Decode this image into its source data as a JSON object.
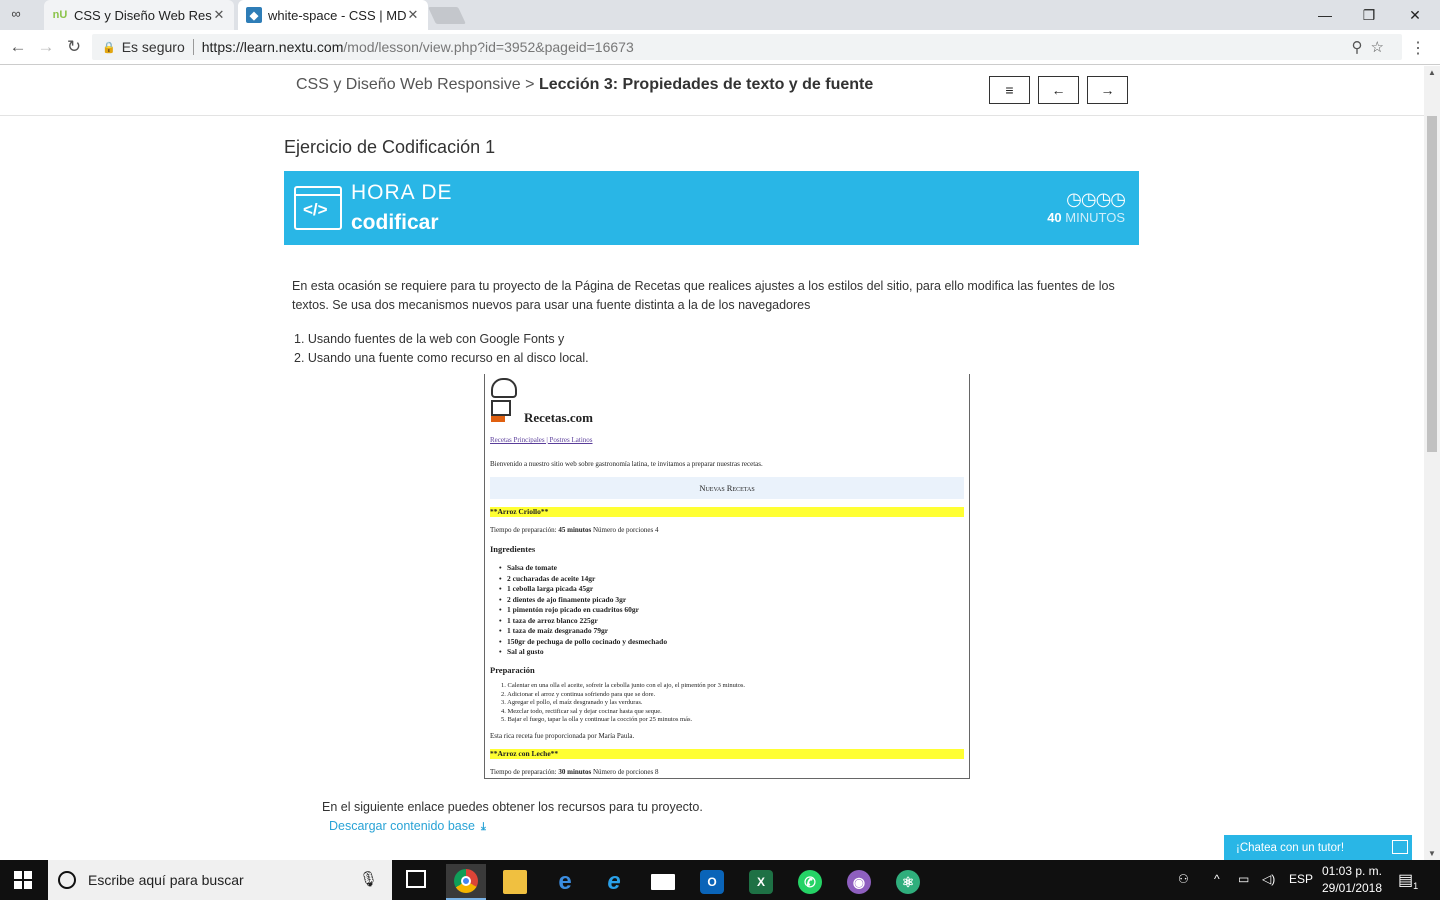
{
  "browser": {
    "tabs": [
      {
        "favicon": "nU",
        "title": "CSS y Diseño Web Respo",
        "close": "✕"
      },
      {
        "favicon": "◆",
        "title": "white-space - CSS | MDN",
        "close": "✕"
      }
    ],
    "window_buttons": {
      "minimize": "—",
      "restore": "❐",
      "close": "✕"
    },
    "nav": {
      "back": "←",
      "forward": "→",
      "reload": "↻"
    },
    "address": {
      "secure_label": "Es seguro",
      "url_host": "https://learn.nextu.com",
      "url_path": "/mod/lesson/view.php?id=3952&pageid=16673"
    },
    "toolbar_icons": {
      "zoom": "⚲",
      "star": "☆",
      "menu": "⋮"
    }
  },
  "lesson_header": {
    "breadcrumb_course": "CSS y Diseño Web Responsive",
    "breadcrumb_sep": ">",
    "breadcrumb_lesson": "Lección 3: Propiedades de texto y de fuente",
    "buttons": {
      "menu": "≡",
      "prev": "←",
      "next": "→"
    }
  },
  "page": {
    "title": "Ejercicio de Codificación 1",
    "banner": {
      "line1": "HORA DE",
      "line2": "codificar",
      "code_symbol": "</>",
      "clocks": "🕓🕓🕓🕓",
      "minutes_num": "40",
      "minutes_label": "MINUTOS"
    },
    "intro": "En esta ocasión se requiere para tu proyecto de la Página de Recetas que realices ajustes a los estilos del sitio, para ello modifica las fuentes de los textos. Se usa dos mecanismos nuevos para usar una fuente distinta a la de los navegadores",
    "list": [
      "1. Usando fuentes de la web con Google Fonts y",
      "2. Usando una fuente como recurso en al disco local."
    ],
    "resource_text": "En el siguiente enlace puedes obtener los recursos para tu proyecto.",
    "download_link": "Descargar contenido base",
    "download_icon": "⤓",
    "chat": "¡Chatea con un tutor!"
  },
  "preview": {
    "brand": "Recetas.com",
    "links": "Recetas Principales | Postres Latinos",
    "welcome": "Bienvenido a nuestro sitio web sobre gastronomía latina, te invitamos a preparar nuestras recetas.",
    "section": "Nuevas Recetas",
    "recipe1": "**Arroz Criollo**",
    "time1_prefix": "Tiempo de preparación:",
    "time1_value": "45 minutos",
    "time1_suffix": "Número de porciones 4",
    "ingredients_heading": "Ingredientes",
    "ingredients": [
      "Salsa de tomate",
      "2 cucharadas de aceite 14gr",
      "1 cebolla larga picada 45gr",
      "2 dientes de ajo finamente picado 3gr",
      "1 pimentón rojo picado en cuadritos 60gr",
      "1 taza de arroz blanco 225gr",
      "1 taza de maíz desgranado 79gr",
      "150gr de pechuga de pollo cocinado y desmechado",
      "Sal al gusto"
    ],
    "prep_heading": "Preparación",
    "steps": [
      "1. Calentar en una olla el aceite, sofreir la cebolla junto con el ajo, el pimentón por 3 minutos.",
      "2. Adicionar el arroz y continua sofriendo para que se dore.",
      "3. Agregar el pollo, el maíz desgranado y las verduras.",
      "4. Mezclar todo, rectificar sal y dejar cocinar hasta que seque.",
      "5. Bajar el fuego, tapar la olla y continuar la cocción por 25 minutos más."
    ],
    "credit": "Esta rica receta fue proporcionada por María Paula.",
    "recipe2": "**Arroz con Leche**",
    "time2_prefix": "Tiempo de preparación:",
    "time2_value": "30 minutos",
    "time2_suffix": "Número de porciones 8"
  },
  "taskbar": {
    "search_placeholder": "Escribe aquí para buscar",
    "lang": "ESP",
    "time": "01:03 p. m.",
    "date": "29/01/2018",
    "notif_count": "1"
  }
}
